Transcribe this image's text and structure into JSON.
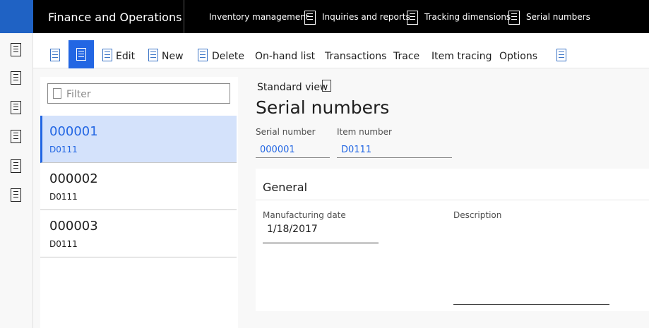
{
  "topbar": {
    "app_title": "Finance and Operations",
    "breadcrumbs": [
      "Inventory management",
      "Inquiries and reports",
      "Tracking dimensions",
      "Serial numbers"
    ]
  },
  "actions": {
    "edit": "Edit",
    "new": "New",
    "delete": "Delete",
    "onhand": "On-hand list",
    "transactions": "Transactions",
    "trace": "Trace",
    "item_tracing": "Item tracing",
    "options": "Options"
  },
  "list": {
    "filter_placeholder": "Filter",
    "rows": [
      {
        "serial": "000001",
        "item": "D0111",
        "selected": true
      },
      {
        "serial": "000002",
        "item": "D0111",
        "selected": false
      },
      {
        "serial": "000003",
        "item": "D0111",
        "selected": false
      }
    ]
  },
  "details": {
    "view_name": "Standard view",
    "title": "Serial numbers",
    "serial_label": "Serial number",
    "serial_value": "000001",
    "item_label": "Item number",
    "item_value": "D0111",
    "general": {
      "title": "General",
      "mfg_label": "Manufacturing date",
      "mfg_value": "1/18/2017",
      "desc_label": "Description",
      "desc_value": ""
    }
  },
  "colors": {
    "accent": "#2266e3",
    "topbar": "#000000",
    "selected_row": "#d4e2fb"
  }
}
